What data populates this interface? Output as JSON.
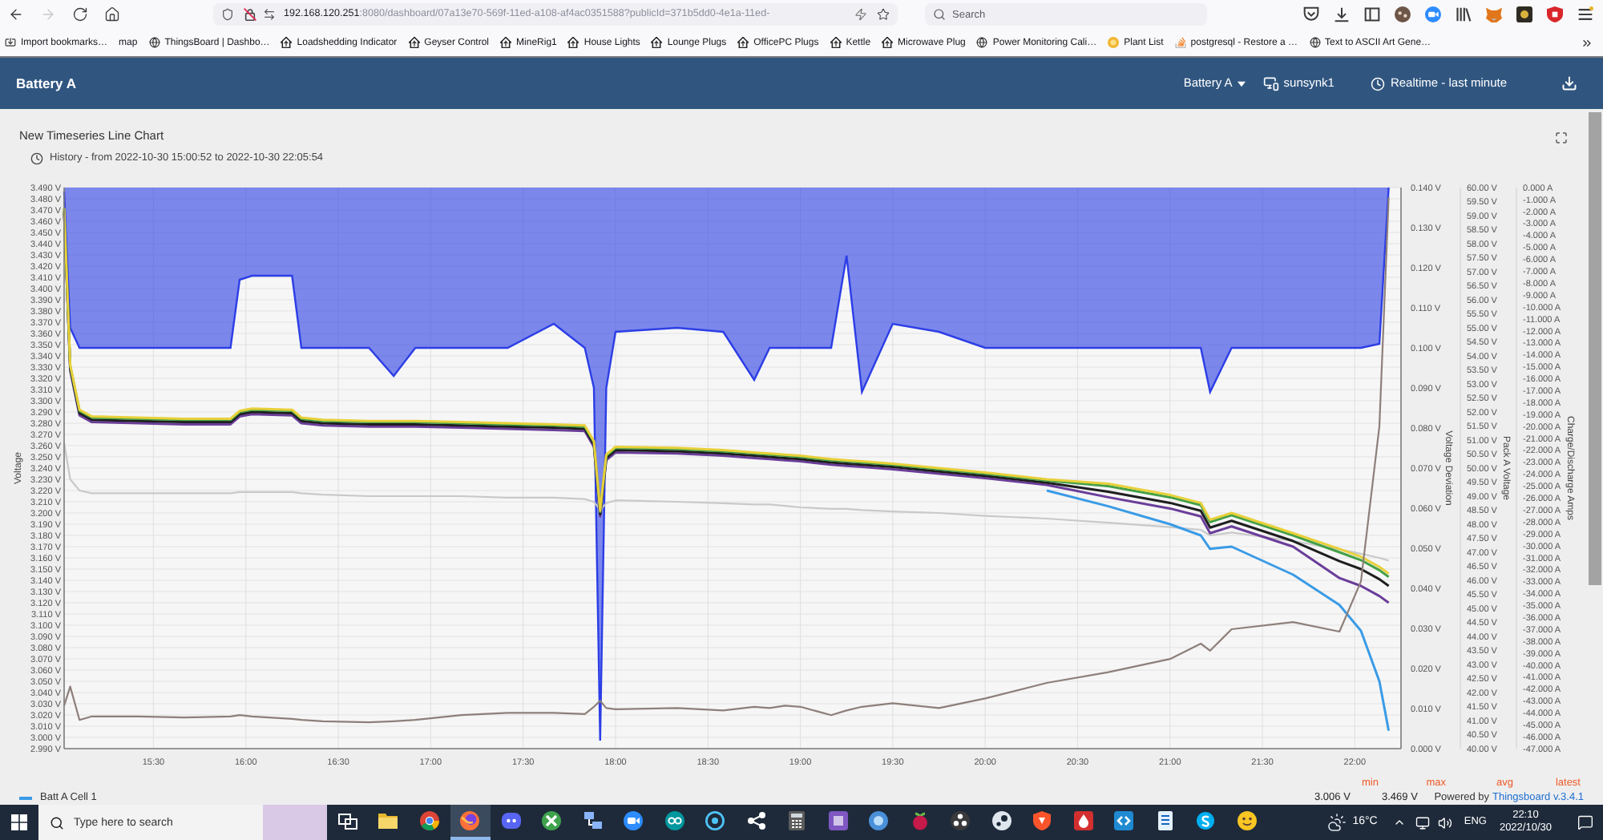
{
  "browser": {
    "forward_disabled": true,
    "url": {
      "host": "192.168.120.251",
      "rest": ":8080/dashboard/07a13e70-569f-11ed-a108-af4ac0351588?publicId=371b5dd0-4e1a-11ed-"
    },
    "search": {
      "placeholder": "Search"
    }
  },
  "bookmarks": [
    "Import bookmarks…",
    "map",
    "ThingsBoard | Dashbo…",
    "Loadshedding Indicator",
    "Geyser Control",
    "MineRig1",
    "House Lights",
    "Lounge Plugs",
    "OfficePC Plugs",
    "Kettle",
    "Microwave Plug",
    "Power Monitoring Cali…",
    "Plant List",
    "postgresql - Restore a …",
    "Text to ASCII Art Gene…"
  ],
  "header": {
    "title": "Battery A",
    "entity_select": "Battery A",
    "device": "sunsynk1",
    "timewindow": "Realtime - last minute"
  },
  "widget": {
    "title": "New Timeseries Line Chart",
    "subtitle": "History - from 2022-10-30 15:00:52 to 2022-10-30 22:05:54",
    "chart_data": {
      "type": "line",
      "grid": true,
      "ylabel": "Voltage",
      "xlim": [
        901,
        1335
      ],
      "ylim": [
        2.99,
        3.49
      ],
      "xticks": [
        {
          "value": 930,
          "label": "15:30"
        },
        {
          "value": 960,
          "label": "16:00"
        },
        {
          "value": 990,
          "label": "16:30"
        },
        {
          "value": 1020,
          "label": "17:00"
        },
        {
          "value": 1050,
          "label": "17:30"
        },
        {
          "value": 1080,
          "label": "18:00"
        },
        {
          "value": 1110,
          "label": "18:30"
        },
        {
          "value": 1140,
          "label": "19:00"
        },
        {
          "value": 1170,
          "label": "19:30"
        },
        {
          "value": 1200,
          "label": "20:00"
        },
        {
          "value": 1230,
          "label": "20:30"
        },
        {
          "value": 1260,
          "label": "21:00"
        },
        {
          "value": 1290,
          "label": "21:30"
        },
        {
          "value": 1320,
          "label": "22:00"
        }
      ],
      "yticks": [
        {
          "value": 3.49,
          "label": "3.490 V"
        },
        {
          "value": 3.48,
          "label": "3.480 V"
        },
        {
          "value": 3.47,
          "label": "3.470 V"
        },
        {
          "value": 3.46,
          "label": "3.460 V"
        },
        {
          "value": 3.45,
          "label": "3.450 V"
        },
        {
          "value": 3.44,
          "label": "3.440 V"
        },
        {
          "value": 3.43,
          "label": "3.430 V"
        },
        {
          "value": 3.42,
          "label": "3.420 V"
        },
        {
          "value": 3.41,
          "label": "3.410 V"
        },
        {
          "value": 3.4,
          "label": "3.400 V"
        },
        {
          "value": 3.39,
          "label": "3.390 V"
        },
        {
          "value": 3.38,
          "label": "3.380 V"
        },
        {
          "value": 3.37,
          "label": "3.370 V"
        },
        {
          "value": 3.36,
          "label": "3.360 V"
        },
        {
          "value": 3.35,
          "label": "3.350 V"
        },
        {
          "value": 3.34,
          "label": "3.340 V"
        },
        {
          "value": 3.33,
          "label": "3.330 V"
        },
        {
          "value": 3.32,
          "label": "3.320 V"
        },
        {
          "value": 3.31,
          "label": "3.310 V"
        },
        {
          "value": 3.3,
          "label": "3.300 V"
        },
        {
          "value": 3.29,
          "label": "3.290 V"
        },
        {
          "value": 3.28,
          "label": "3.280 V"
        },
        {
          "value": 3.27,
          "label": "3.270 V"
        },
        {
          "value": 3.26,
          "label": "3.260 V"
        },
        {
          "value": 3.25,
          "label": "3.250 V"
        },
        {
          "value": 3.24,
          "label": "3.240 V"
        },
        {
          "value": 3.23,
          "label": "3.230 V"
        },
        {
          "value": 3.22,
          "label": "3.220 V"
        },
        {
          "value": 3.21,
          "label": "3.210 V"
        },
        {
          "value": 3.2,
          "label": "3.200 V"
        },
        {
          "value": 3.19,
          "label": "3.190 V"
        },
        {
          "value": 3.18,
          "label": "3.180 V"
        },
        {
          "value": 3.17,
          "label": "3.170 V"
        },
        {
          "value": 3.16,
          "label": "3.160 V"
        },
        {
          "value": 3.15,
          "label": "3.150 V"
        },
        {
          "value": 3.14,
          "label": "3.140 V"
        },
        {
          "value": 3.13,
          "label": "3.130 V"
        },
        {
          "value": 3.12,
          "label": "3.120 V"
        },
        {
          "value": 3.11,
          "label": "3.110 V"
        },
        {
          "value": 3.1,
          "label": "3.100 V"
        },
        {
          "value": 3.09,
          "label": "3.090 V"
        },
        {
          "value": 3.08,
          "label": "3.080 V"
        },
        {
          "value": 3.07,
          "label": "3.070 V"
        },
        {
          "value": 3.06,
          "label": "3.060 V"
        },
        {
          "value": 3.05,
          "label": "3.050 V"
        },
        {
          "value": 3.04,
          "label": "3.040 V"
        },
        {
          "value": 3.03,
          "label": "3.030 V"
        },
        {
          "value": 3.02,
          "label": "3.020 V"
        },
        {
          "value": 3.01,
          "label": "3.010 V"
        },
        {
          "value": 3.0,
          "label": "3.000 V"
        },
        {
          "value": 2.99,
          "label": "2.990 V"
        }
      ],
      "y2label": "Voltage Deviation",
      "y2lim": [
        0,
        0.14
      ],
      "y2ticks": [
        {
          "value": 0.14,
          "label": "0.140 V"
        },
        {
          "value": 0.13,
          "label": "0.130 V"
        },
        {
          "value": 0.12,
          "label": "0.120 V"
        },
        {
          "value": 0.11,
          "label": "0.110 V"
        },
        {
          "value": 0.1,
          "label": "0.100 V"
        },
        {
          "value": 0.09,
          "label": "0.090 V"
        },
        {
          "value": 0.08,
          "label": "0.080 V"
        },
        {
          "value": 0.07,
          "label": "0.070 V"
        },
        {
          "value": 0.06,
          "label": "0.060 V"
        },
        {
          "value": 0.05,
          "label": "0.050 V"
        },
        {
          "value": 0.04,
          "label": "0.040 V"
        },
        {
          "value": 0.03,
          "label": "0.030 V"
        },
        {
          "value": 0.02,
          "label": "0.020 V"
        },
        {
          "value": 0.01,
          "label": "0.010 V"
        },
        {
          "value": 0,
          "label": "0.000 V"
        }
      ],
      "y3label": "Pack A Voltage",
      "y3lim": [
        40,
        60
      ],
      "y3ticks": [
        {
          "value": 60,
          "label": "60.00 V"
        },
        {
          "value": 59.5,
          "label": "59.50 V"
        },
        {
          "value": 59,
          "label": "59.00 V"
        },
        {
          "value": 58.5,
          "label": "58.50 V"
        },
        {
          "value": 58,
          "label": "58.00 V"
        },
        {
          "value": 57.5,
          "label": "57.50 V"
        },
        {
          "value": 57,
          "label": "57.00 V"
        },
        {
          "value": 56.5,
          "label": "56.50 V"
        },
        {
          "value": 56,
          "label": "56.00 V"
        },
        {
          "value": 55.5,
          "label": "55.50 V"
        },
        {
          "value": 55,
          "label": "55.00 V"
        },
        {
          "value": 54.5,
          "label": "54.50 V"
        },
        {
          "value": 54,
          "label": "54.00 V"
        },
        {
          "value": 53.5,
          "label": "53.50 V"
        },
        {
          "value": 53,
          "label": "53.00 V"
        },
        {
          "value": 52.5,
          "label": "52.50 V"
        },
        {
          "value": 52,
          "label": "52.00 V"
        },
        {
          "value": 51.5,
          "label": "51.50 V"
        },
        {
          "value": 51,
          "label": "51.00 V"
        },
        {
          "value": 50.5,
          "label": "50.50 V"
        },
        {
          "value": 50,
          "label": "50.00 V"
        },
        {
          "value": 49.5,
          "label": "49.50 V"
        },
        {
          "value": 49,
          "label": "49.00 V"
        },
        {
          "value": 48.5,
          "label": "48.50 V"
        },
        {
          "value": 48,
          "label": "48.00 V"
        },
        {
          "value": 47.5,
          "label": "47.50 V"
        },
        {
          "value": 47,
          "label": "47.00 V"
        },
        {
          "value": 46.5,
          "label": "46.50 V"
        },
        {
          "value": 46,
          "label": "46.00 V"
        },
        {
          "value": 45.5,
          "label": "45.50 V"
        },
        {
          "value": 45,
          "label": "45.00 V"
        },
        {
          "value": 44.5,
          "label": "44.50 V"
        },
        {
          "value": 44,
          "label": "44.00 V"
        },
        {
          "value": 43.5,
          "label": "43.50 V"
        },
        {
          "value": 43,
          "label": "43.00 V"
        },
        {
          "value": 42.5,
          "label": "42.50 V"
        },
        {
          "value": 42,
          "label": "42.00 V"
        },
        {
          "value": 41.5,
          "label": "41.50 V"
        },
        {
          "value": 41,
          "label": "41.00 V"
        },
        {
          "value": 40.5,
          "label": "40.50 V"
        },
        {
          "value": 40,
          "label": "40.00 V"
        }
      ],
      "x": [
        901,
        903,
        906,
        910,
        925,
        940,
        955,
        958,
        962,
        975,
        978,
        985,
        1000,
        1008,
        1015,
        1030,
        1045,
        1060,
        1070,
        1073,
        1075,
        1077,
        1080,
        1100,
        1115,
        1125,
        1130,
        1135,
        1140,
        1150,
        1155,
        1160,
        1170,
        1185,
        1200,
        1220,
        1240,
        1260,
        1270,
        1273,
        1280,
        1300,
        1315,
        1322,
        1328,
        1331
      ],
      "series": [
        {
          "type": "area",
          "axis": "y2",
          "color": "#2c3ee6",
          "values": [
            0.139,
            0.105,
            0.1,
            0.1,
            0.1,
            0.1,
            0.1,
            0.117,
            0.118,
            0.118,
            0.1,
            0.1,
            0.1,
            0.093,
            0.1,
            0.1,
            0.1,
            0.106,
            0.1,
            0.09,
            0.002,
            0.09,
            0.104,
            0.105,
            0.104,
            0.092,
            0.1,
            0.1,
            0.1,
            0.1,
            0.123,
            0.089,
            0.106,
            0.104,
            0.1,
            0.1,
            0.1,
            0.1,
            0.1,
            0.089,
            0.1,
            0.1,
            0.1,
            0.1,
            0.101,
            0.14
          ]
        },
        {
          "axis": "y3",
          "color": "#c9c9c9",
          "values": [
            50.9,
            49.6,
            49.2,
            49.1,
            49.1,
            49.1,
            49.1,
            49.15,
            49.15,
            49.15,
            49.1,
            49.05,
            49.0,
            49.0,
            49.0,
            49.0,
            48.95,
            48.95,
            48.9,
            48.8,
            48.5,
            48.75,
            48.85,
            48.8,
            48.75,
            48.7,
            48.7,
            48.65,
            48.6,
            48.55,
            48.55,
            48.5,
            48.45,
            48.4,
            48.3,
            48.2,
            48.05,
            47.9,
            47.8,
            47.6,
            47.7,
            47.4,
            47.1,
            46.95,
            46.8,
            46.7
          ]
        },
        {
          "color": "#3a9be6",
          "values": [
            null,
            null,
            null,
            null,
            null,
            null,
            null,
            null,
            null,
            null,
            null,
            null,
            null,
            null,
            null,
            null,
            null,
            null,
            null,
            null,
            null,
            null,
            null,
            null,
            null,
            null,
            null,
            null,
            null,
            null,
            null,
            null,
            null,
            null,
            null,
            3.22,
            3.206,
            3.19,
            3.18,
            3.168,
            3.17,
            3.145,
            3.118,
            3.095,
            3.05,
            3.006
          ]
        },
        {
          "color": "#6a3d9a",
          "values": [
            3.467,
            3.327,
            3.287,
            3.281,
            3.28,
            3.279,
            3.279,
            3.286,
            3.288,
            3.287,
            3.28,
            3.278,
            3.277,
            3.277,
            3.277,
            3.276,
            3.275,
            3.274,
            3.273,
            3.259,
            3.197,
            3.247,
            3.254,
            3.253,
            3.251,
            3.249,
            3.248,
            3.247,
            3.246,
            3.243,
            3.242,
            3.241,
            3.239,
            3.235,
            3.231,
            3.225,
            3.214,
            3.204,
            3.197,
            3.182,
            3.188,
            3.17,
            3.142,
            3.135,
            3.126,
            3.12
          ]
        },
        {
          "color": "#1e1e1e",
          "values": [
            3.469,
            3.329,
            3.289,
            3.283,
            3.282,
            3.281,
            3.281,
            3.288,
            3.29,
            3.289,
            3.282,
            3.28,
            3.279,
            3.279,
            3.279,
            3.278,
            3.277,
            3.276,
            3.275,
            3.261,
            3.199,
            3.249,
            3.256,
            3.255,
            3.253,
            3.251,
            3.25,
            3.249,
            3.248,
            3.245,
            3.244,
            3.243,
            3.241,
            3.237,
            3.233,
            3.227,
            3.219,
            3.209,
            3.202,
            3.187,
            3.193,
            3.175,
            3.157,
            3.15,
            3.141,
            3.135
          ]
        },
        {
          "color": "#43a047",
          "values": [
            3.471,
            3.331,
            3.291,
            3.285,
            3.284,
            3.283,
            3.283,
            3.29,
            3.292,
            3.291,
            3.284,
            3.282,
            3.281,
            3.281,
            3.281,
            3.28,
            3.279,
            3.278,
            3.277,
            3.263,
            3.201,
            3.251,
            3.258,
            3.257,
            3.255,
            3.253,
            3.252,
            3.251,
            3.25,
            3.247,
            3.246,
            3.245,
            3.243,
            3.239,
            3.235,
            3.229,
            3.224,
            3.214,
            3.207,
            3.192,
            3.198,
            3.18,
            3.165,
            3.158,
            3.149,
            3.143
          ]
        },
        {
          "color": "#e8d03a",
          "values": [
            3.472,
            3.332,
            3.292,
            3.286,
            3.285,
            3.284,
            3.284,
            3.291,
            3.293,
            3.292,
            3.285,
            3.283,
            3.282,
            3.282,
            3.282,
            3.281,
            3.28,
            3.279,
            3.278,
            3.264,
            3.202,
            3.252,
            3.259,
            3.258,
            3.256,
            3.254,
            3.253,
            3.252,
            3.251,
            3.248,
            3.247,
            3.246,
            3.244,
            3.24,
            3.236,
            3.23,
            3.226,
            3.216,
            3.209,
            3.194,
            3.2,
            3.182,
            3.168,
            3.161,
            3.152,
            3.146
          ]
        }
      ]
    },
    "current_overlay": {
      "chart_data": {
        "type": "line",
        "ylabel": "Charge/Discharge Amps",
        "xlim": [
          901,
          1335
        ],
        "ylim": [
          -47,
          0
        ],
        "yticks": [
          {
            "value": 0,
            "label": "0.000 A"
          },
          {
            "value": -1,
            "label": "-1.000 A"
          },
          {
            "value": -2,
            "label": "-2.000 A"
          },
          {
            "value": -3,
            "label": "-3.000 A"
          },
          {
            "value": -4,
            "label": "-4.000 A"
          },
          {
            "value": -5,
            "label": "-5.000 A"
          },
          {
            "value": -6,
            "label": "-6.000 A"
          },
          {
            "value": -7,
            "label": "-7.000 A"
          },
          {
            "value": -8,
            "label": "-8.000 A"
          },
          {
            "value": -9,
            "label": "-9.000 A"
          },
          {
            "value": -10,
            "label": "-10.000 A"
          },
          {
            "value": -11,
            "label": "-11.000 A"
          },
          {
            "value": -12,
            "label": "-12.000 A"
          },
          {
            "value": -13,
            "label": "-13.000 A"
          },
          {
            "value": -14,
            "label": "-14.000 A"
          },
          {
            "value": -15,
            "label": "-15.000 A"
          },
          {
            "value": -16,
            "label": "-16.000 A"
          },
          {
            "value": -17,
            "label": "-17.000 A"
          },
          {
            "value": -18,
            "label": "-18.000 A"
          },
          {
            "value": -19,
            "label": "-19.000 A"
          },
          {
            "value": -20,
            "label": "-20.000 A"
          },
          {
            "value": -21,
            "label": "-21.000 A"
          },
          {
            "value": -22,
            "label": "-22.000 A"
          },
          {
            "value": -23,
            "label": "-23.000 A"
          },
          {
            "value": -24,
            "label": "-24.000 A"
          },
          {
            "value": -25,
            "label": "-25.000 A"
          },
          {
            "value": -26,
            "label": "-26.000 A"
          },
          {
            "value": -27,
            "label": "-27.000 A"
          },
          {
            "value": -28,
            "label": "-28.000 A"
          },
          {
            "value": -29,
            "label": "-29.000 A"
          },
          {
            "value": -30,
            "label": "-30.000 A"
          },
          {
            "value": -31,
            "label": "-31.000 A"
          },
          {
            "value": -32,
            "label": "-32.000 A"
          },
          {
            "value": -33,
            "label": "-33.000 A"
          },
          {
            "value": -34,
            "label": "-34.000 A"
          },
          {
            "value": -35,
            "label": "-35.000 A"
          },
          {
            "value": -36,
            "label": "-36.000 A"
          },
          {
            "value": -37,
            "label": "-37.000 A"
          },
          {
            "value": -38,
            "label": "-38.000 A"
          },
          {
            "value": -39,
            "label": "-39.000 A"
          },
          {
            "value": -40,
            "label": "-40.000 A"
          },
          {
            "value": -41,
            "label": "-41.000 A"
          },
          {
            "value": -42,
            "label": "-42.000 A"
          },
          {
            "value": -43,
            "label": "-43.000 A"
          },
          {
            "value": -44,
            "label": "-44.000 A"
          },
          {
            "value": -45,
            "label": "-45.000 A"
          },
          {
            "value": -46,
            "label": "-46.000 A"
          },
          {
            "value": -47,
            "label": "-47.000 A"
          }
        ],
        "x": [
          901,
          903,
          906,
          910,
          925,
          940,
          955,
          958,
          962,
          975,
          978,
          985,
          1000,
          1008,
          1015,
          1030,
          1045,
          1060,
          1070,
          1073,
          1075,
          1077,
          1080,
          1100,
          1115,
          1125,
          1130,
          1135,
          1140,
          1150,
          1155,
          1160,
          1170,
          1185,
          1200,
          1220,
          1240,
          1260,
          1270,
          1273,
          1280,
          1300,
          1315,
          1322,
          1328,
          1331
        ],
        "series": [
          {
            "color": "#8d7f7a",
            "values": [
              -43.4,
              -41.8,
              -44.6,
              -44.3,
              -44.3,
              -44.4,
              -44.3,
              -44.2,
              -44.3,
              -44.5,
              -44.6,
              -44.7,
              -44.8,
              -44.7,
              -44.6,
              -44.2,
              -44.0,
              -44.0,
              -44.1,
              -43.5,
              -43.0,
              -43.6,
              -43.7,
              -43.6,
              -43.8,
              -43.5,
              -43.6,
              -43.4,
              -43.5,
              -44.2,
              -43.8,
              -43.5,
              -43.2,
              -43.6,
              -42.8,
              -41.5,
              -40.6,
              -39.5,
              -38.2,
              -38.8,
              -37.0,
              -36.4,
              -37.2,
              -33.0,
              -20.0,
              -0.8
            ]
          }
        ]
      }
    },
    "legend": {
      "headers": [
        "min",
        "max",
        "avg",
        "latest"
      ],
      "items": [
        {
          "label": "Batt A Cell 1",
          "color": "#3a9be6",
          "min": "3.006 V",
          "max": "3.469 V"
        }
      ]
    },
    "footer": {
      "text": "Powered by",
      "link": "Thingsboard v.3.4.1"
    }
  },
  "taskbar": {
    "search": {
      "placeholder": "Type here to search"
    },
    "apps": [
      {
        "active": false
      },
      {
        "active": false
      },
      {
        "active": false
      },
      {
        "active": true
      },
      {
        "active": false
      },
      {
        "active": false
      },
      {
        "active": false
      },
      {
        "active": false
      },
      {
        "active": false
      },
      {
        "active": false
      },
      {
        "active": false
      },
      {
        "active": false
      },
      {
        "active": false
      },
      {
        "active": false
      },
      {
        "active": false
      },
      {
        "active": false
      },
      {
        "active": false
      },
      {
        "active": false
      },
      {
        "active": false
      },
      {
        "active": false
      },
      {
        "active": false
      },
      {
        "active": false
      },
      {
        "active": false
      }
    ],
    "weather": "16°C",
    "language": "ENG",
    "time": "22:10",
    "date": "2022/10/30"
  }
}
